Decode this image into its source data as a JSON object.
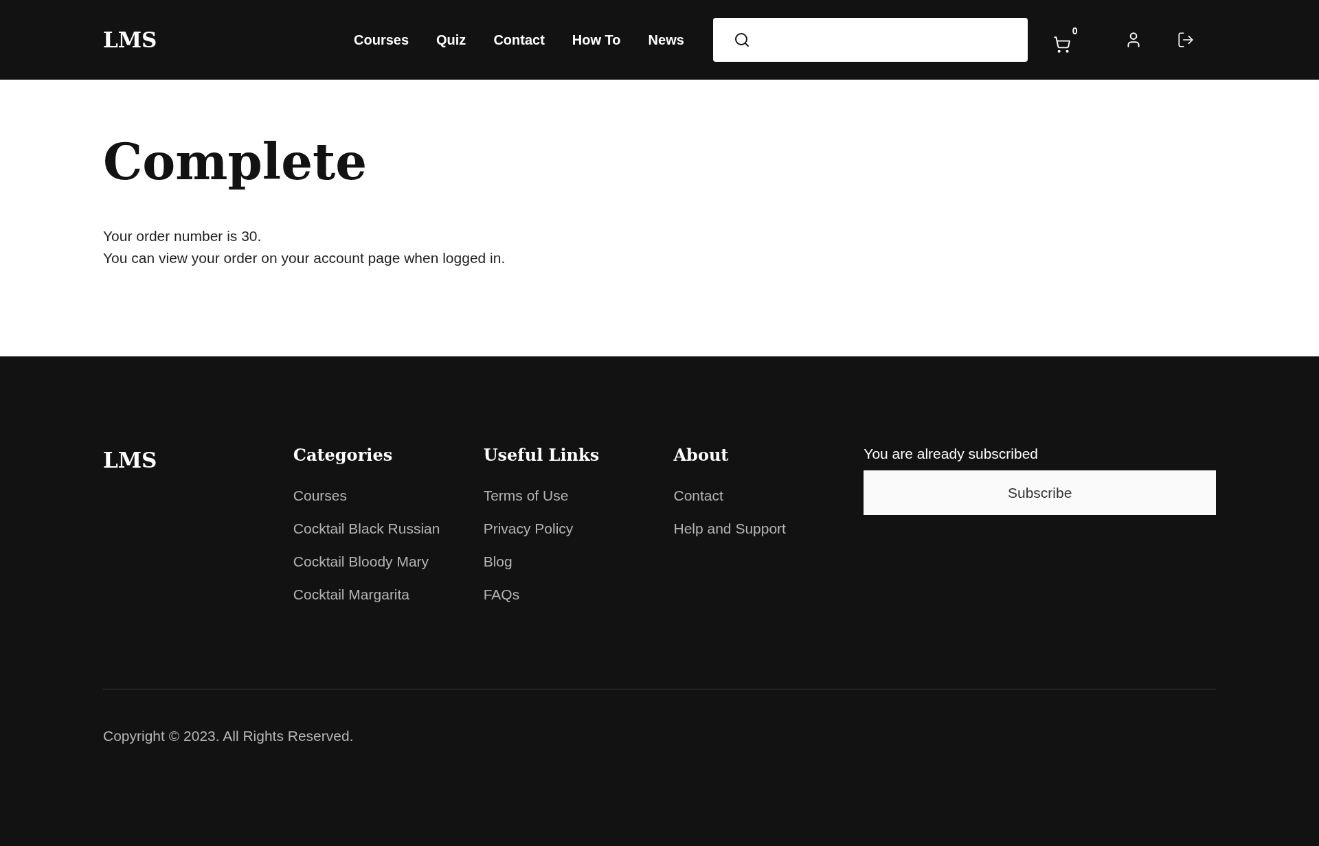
{
  "header": {
    "logo": "LMS",
    "nav": [
      "Courses",
      "Quiz",
      "Contact",
      "How To",
      "News"
    ],
    "cart_count": "0"
  },
  "main": {
    "title": "Complete",
    "lines": [
      "Your order number is 30.",
      "You can view your order on your account page when logged in."
    ]
  },
  "footer": {
    "logo": "LMS",
    "columns": [
      {
        "heading": "Categories",
        "links": [
          "Courses",
          "Cocktail Black Russian",
          "Cocktail Bloody Mary",
          "Cocktail Margarita"
        ]
      },
      {
        "heading": "Useful Links",
        "links": [
          "Terms of Use",
          "Privacy Policy",
          "Blog",
          "FAQs"
        ]
      },
      {
        "heading": "About",
        "links": [
          "Contact",
          "Help and Support"
        ]
      }
    ],
    "subscribe": {
      "note": "You are already subscribed",
      "button": "Subscribe"
    },
    "copyright": "Copyright © 2023. All Rights Reserved."
  }
}
